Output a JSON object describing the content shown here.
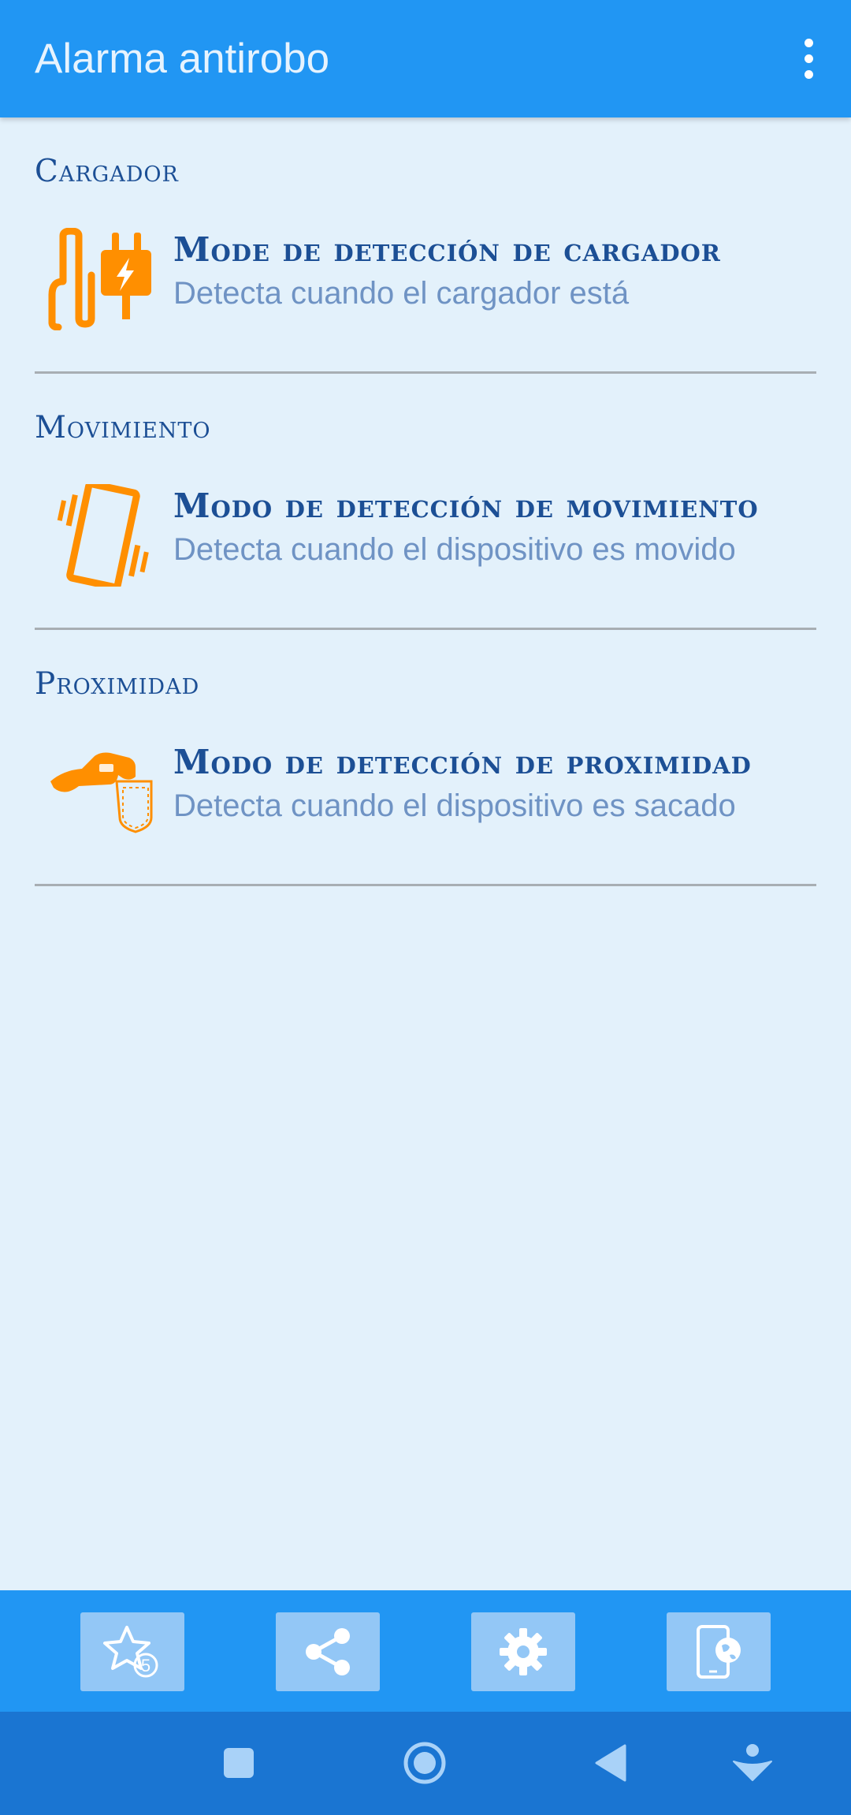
{
  "app_bar": {
    "title": "Alarma antirobo",
    "menu_icon": "more-vert-icon"
  },
  "sections": [
    {
      "header": "Cargador",
      "item": {
        "title": "Mode de detección de cargador",
        "subtitle": "Detecta cuando el cargador está",
        "icon": "charger-plug-icon"
      }
    },
    {
      "header": "Movimiento",
      "item": {
        "title": "Modo de detección de movimiento",
        "subtitle": "Detecta cuando el dispositivo es movido",
        "icon": "phone-vibrate-icon"
      }
    },
    {
      "header": "Proximidad",
      "item": {
        "title": "Modo de detección de proximidad",
        "subtitle": "Detecta cuando el dispositivo es sacado",
        "icon": "hand-pocket-icon"
      }
    }
  ],
  "bottom_bar": {
    "buttons": [
      {
        "icon": "rate-star-icon",
        "badge": "5"
      },
      {
        "icon": "share-icon"
      },
      {
        "icon": "gear-icon"
      },
      {
        "icon": "phone-globe-icon"
      }
    ]
  },
  "nav_bar": {
    "buttons": [
      "recents-square-icon",
      "home-circle-icon",
      "back-triangle-icon",
      "assistant-icon"
    ]
  },
  "colors": {
    "app_bar": "#2196f3",
    "background": "#e3f1fb",
    "accent_orange": "#ff8f00",
    "title_text": "#1c4f95",
    "subtitle_text": "#6f93c4",
    "bottom_button": "#93c7f6",
    "nav_bar": "#1a75d2"
  }
}
